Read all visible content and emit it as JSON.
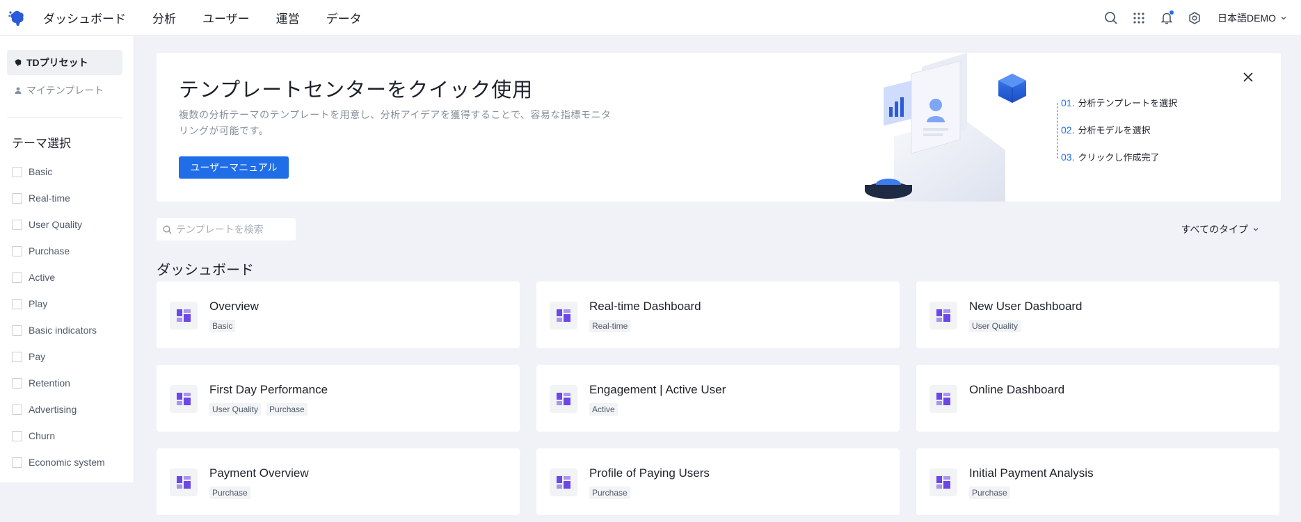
{
  "nav": {
    "items": [
      "ダッシュボード",
      "分析",
      "ユーザー",
      "運営",
      "データ"
    ],
    "language": "日本語DEMO"
  },
  "sidebar": {
    "tabs": [
      {
        "label": "TDプリセット",
        "active": true
      },
      {
        "label": "マイテンプレート",
        "active": false
      }
    ],
    "theme_title": "テーマ選択",
    "themes": [
      "Basic",
      "Real-time",
      "User Quality",
      "Purchase",
      "Active",
      "Play",
      "Basic indicators",
      "Pay",
      "Retention",
      "Advertising",
      "Churn",
      "Economic system"
    ]
  },
  "banner": {
    "title": "テンプレートセンターをクイック使用",
    "description": "複数の分析テーマのテンプレートを用意し、分析アイデアを獲得することで、容易な指標モニタリングが可能です。",
    "button_label": "ユーザーマニュアル",
    "steps": [
      {
        "num": "01.",
        "label": "分析テンプレートを選択"
      },
      {
        "num": "02.",
        "label": "分析モデルを選択"
      },
      {
        "num": "03.",
        "label": "クリックし作成完了"
      }
    ]
  },
  "search": {
    "placeholder": "テンプレートを検索"
  },
  "type_filter": {
    "label": "すべてのタイプ"
  },
  "section_title": "ダッシュボード",
  "cards": [
    {
      "title": "Overview",
      "tags": [
        "Basic"
      ]
    },
    {
      "title": "Real-time Dashboard",
      "tags": [
        "Real-time"
      ]
    },
    {
      "title": "New User Dashboard",
      "tags": [
        "User Quality"
      ]
    },
    {
      "title": "First Day Performance",
      "tags": [
        "User Quality",
        "Purchase"
      ]
    },
    {
      "title": "Engagement | Active User",
      "tags": [
        "Active"
      ]
    },
    {
      "title": "Online Dashboard",
      "tags": []
    },
    {
      "title": "Payment Overview",
      "tags": [
        "Purchase"
      ]
    },
    {
      "title": "Profile of Paying Users",
      "tags": [
        "Purchase"
      ]
    },
    {
      "title": "Initial Payment Analysis",
      "tags": [
        "Purchase"
      ]
    }
  ],
  "colors": {
    "accent": "#1f6ee8",
    "icon_purple": "#6c47e8",
    "background": "#f0f2f7"
  }
}
